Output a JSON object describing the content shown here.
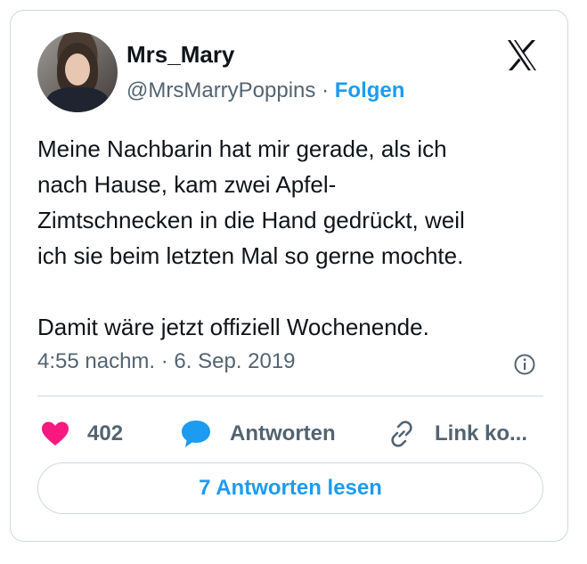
{
  "author": {
    "name": "Mrs_Mary",
    "handle": "@MrsMarryPoppins",
    "separator": "·",
    "follow_label": "Folgen"
  },
  "tweet": {
    "text": "Meine Nachbarin hat mir gerade, als ich\nnach Hause, kam zwei Apfel-\nZimtschnecken in die Hand gedrückt, weil\nich sie beim letzten Mal so gerne mochte.\n\nDamit wäre jetzt offiziell Wochenende.",
    "timestamp": "4:55 nachm. · 6. Sep. 2019"
  },
  "actions": {
    "like_count": "402",
    "reply_label": "Antworten",
    "copy_label": "Link ko..."
  },
  "read_replies_label": "7 Antworten lesen",
  "colors": {
    "accent": "#1d9bf0",
    "like": "#f91880",
    "muted": "#536471",
    "text": "#0f1419",
    "border": "#cfd9de"
  },
  "icons": {
    "brand": "x-logo-icon",
    "info": "info-icon",
    "like": "heart-icon",
    "reply": "speech-bubble-icon",
    "copy": "link-icon"
  }
}
